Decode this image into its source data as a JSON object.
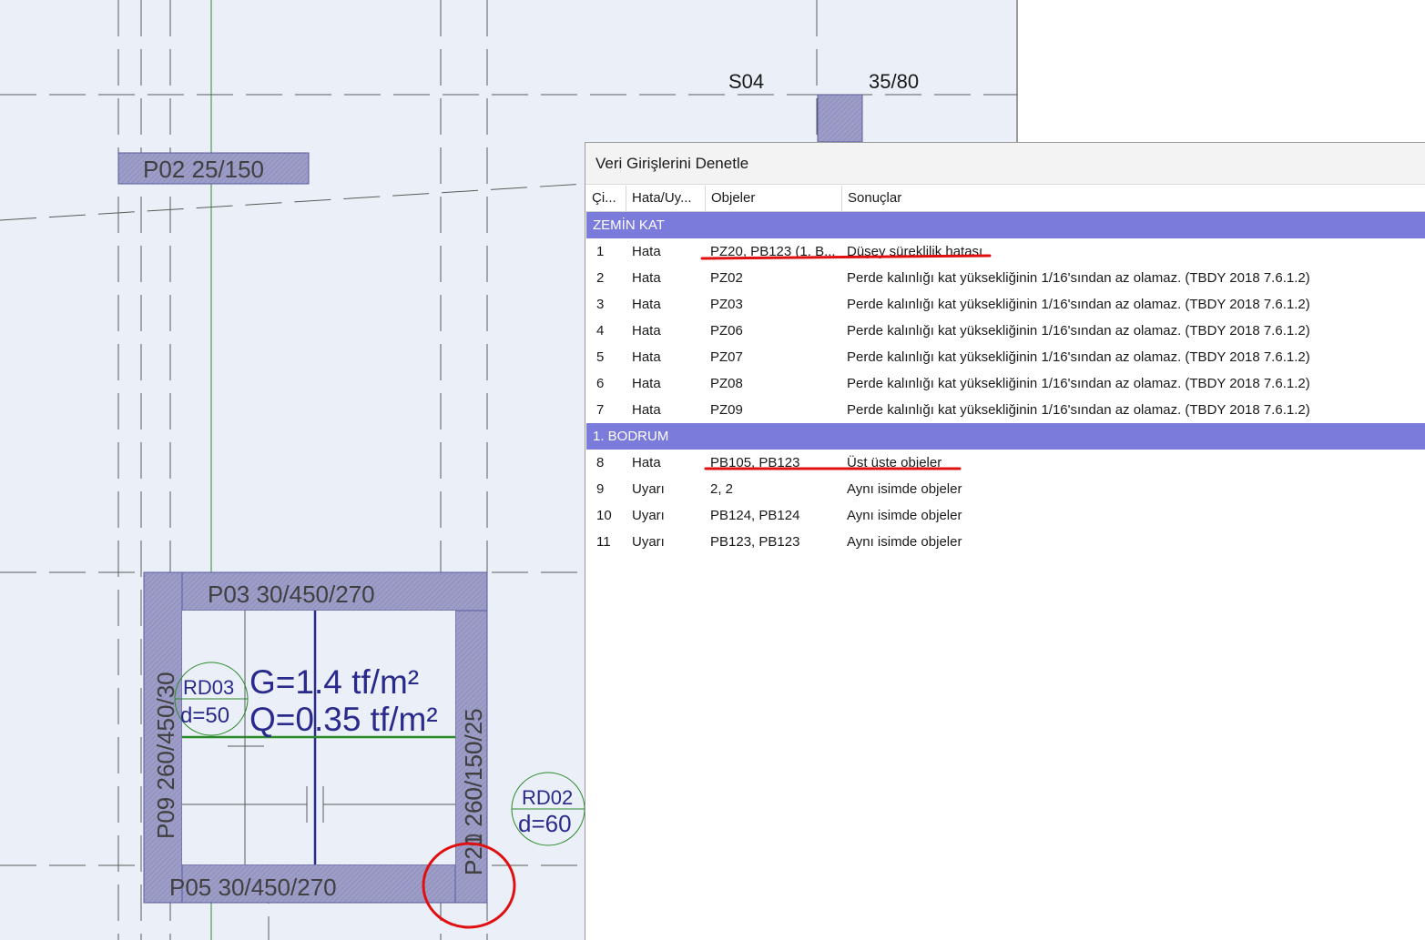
{
  "drawing": {
    "labels": {
      "s04": "S04",
      "s04_dim": "35/80",
      "p02": "P02 25/150",
      "p03": "P03 30/450/270",
      "p05": "P05 30/450/270",
      "p09": "P09 260/450/30",
      "p_right_a": "P21 260/150/25",
      "p_right_b": "P20 260/150",
      "rd03_name": "RD03",
      "rd03_d": "d=50",
      "rd02_name": "RD02",
      "rd02_d": "d=60",
      "load_g": "G=1.4 tf/m²",
      "load_q": "Q=0.35 tf/m²"
    },
    "colors": {
      "background": "#ebf0f8",
      "element_fill": "#9d9dc8",
      "element_stroke": "#5a5aa0",
      "grid_line": "#5a5a5a",
      "green_axis": "#2a8a2a",
      "annotation_red": "#e01010"
    }
  },
  "dialog": {
    "title": "Veri Girişlerini Denetle",
    "columns": [
      "Çi...",
      "Hata/Uy...",
      "Objeler",
      "Sonuçlar"
    ],
    "groups": [
      {
        "name": "ZEMİN KAT",
        "rows": [
          {
            "no": "1",
            "type": "Hata",
            "objects": "PZ20, PB123 (1. B...",
            "result": "Düşey süreklilik hatası"
          },
          {
            "no": "2",
            "type": "Hata",
            "objects": "PZ02",
            "result": "Perde kalınlığı kat yüksekliğinin 1/16'sından az olamaz.  (TBDY 2018 7.6.1.2)"
          },
          {
            "no": "3",
            "type": "Hata",
            "objects": "PZ03",
            "result": "Perde kalınlığı kat yüksekliğinin 1/16'sından az olamaz.  (TBDY 2018 7.6.1.2)"
          },
          {
            "no": "4",
            "type": "Hata",
            "objects": "PZ06",
            "result": "Perde kalınlığı kat yüksekliğinin 1/16'sından az olamaz.  (TBDY 2018 7.6.1.2)"
          },
          {
            "no": "5",
            "type": "Hata",
            "objects": "PZ07",
            "result": "Perde kalınlığı kat yüksekliğinin 1/16'sından az olamaz.  (TBDY 2018 7.6.1.2)"
          },
          {
            "no": "6",
            "type": "Hata",
            "objects": "PZ08",
            "result": "Perde kalınlığı kat yüksekliğinin 1/16'sından az olamaz.  (TBDY 2018 7.6.1.2)"
          },
          {
            "no": "7",
            "type": "Hata",
            "objects": "PZ09",
            "result": "Perde kalınlığı kat yüksekliğinin 1/16'sından az olamaz.  (TBDY 2018 7.6.1.2)"
          }
        ]
      },
      {
        "name": "1. BODRUM",
        "rows": [
          {
            "no": "8",
            "type": "Hata",
            "objects": "PB105, PB123",
            "result": "Üst üste objeler"
          },
          {
            "no": "9",
            "type": "Uyarı",
            "objects": "2, 2",
            "result": "Aynı isimde objeler"
          },
          {
            "no": "10",
            "type": "Uyarı",
            "objects": "PB124, PB124",
            "result": "Aynı isimde objeler"
          },
          {
            "no": "11",
            "type": "Uyarı",
            "objects": "PB123, PB123",
            "result": "Aynı isimde objeler"
          }
        ]
      }
    ]
  }
}
